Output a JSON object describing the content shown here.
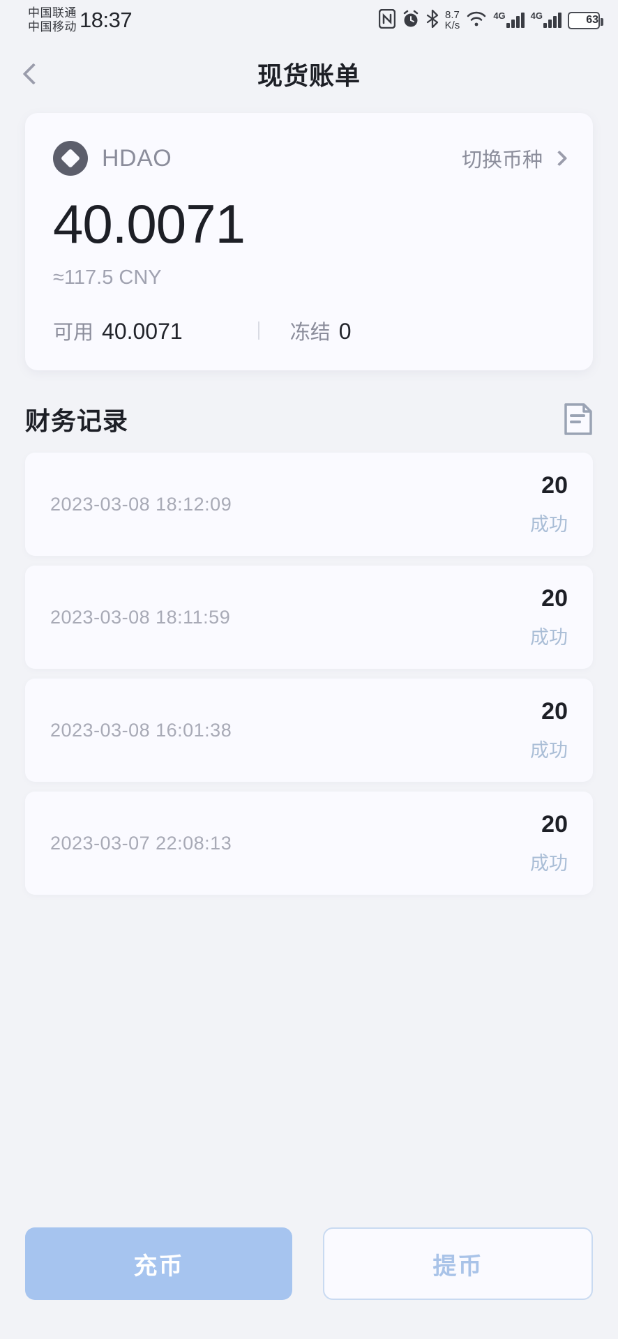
{
  "statusbar": {
    "carrier_line1": "中国联通",
    "carrier_line2": "中国移动",
    "time": "18:37",
    "nfc_icon": "nfc-icon",
    "alarm_icon": "alarm-icon",
    "bluetooth_icon": "bluetooth-icon",
    "net_speed_value": "8.7",
    "net_speed_unit": "K/s",
    "wifi_icon": "wifi-icon",
    "signal1_label": "4G",
    "signal2_label": "4G",
    "battery_percent": "63"
  },
  "navbar": {
    "back_icon": "chevron-left-icon",
    "title": "现货账单"
  },
  "balance_card": {
    "coin_icon": "hdao-coin-icon",
    "coin_symbol": "HDAO",
    "switch_label": "切换币种",
    "switch_chevron": "chevron-right-icon",
    "amount": "40.0071",
    "fiat_value": "≈117.5 CNY",
    "available_label": "可用",
    "available_value": "40.0071",
    "frozen_label": "冻结",
    "frozen_value": "0"
  },
  "records": {
    "title": "财务记录",
    "filter_icon": "document-list-icon",
    "items": [
      {
        "time": "2023-03-08 18:12:09",
        "amount": "20",
        "status": "成功"
      },
      {
        "time": "2023-03-08 18:11:59",
        "amount": "20",
        "status": "成功"
      },
      {
        "time": "2023-03-08 16:01:38",
        "amount": "20",
        "status": "成功"
      },
      {
        "time": "2023-03-07 22:08:13",
        "amount": "20",
        "status": "成功"
      }
    ]
  },
  "actions": {
    "deposit_label": "充币",
    "withdraw_label": "提币"
  },
  "colors": {
    "page_bg": "#f2f3f7",
    "card_bg": "#fafaff",
    "primary": "#a6c4ef",
    "text_dark": "#1d1f26",
    "text_muted": "#8b8d9b",
    "status_text": "#a9bdd6"
  }
}
